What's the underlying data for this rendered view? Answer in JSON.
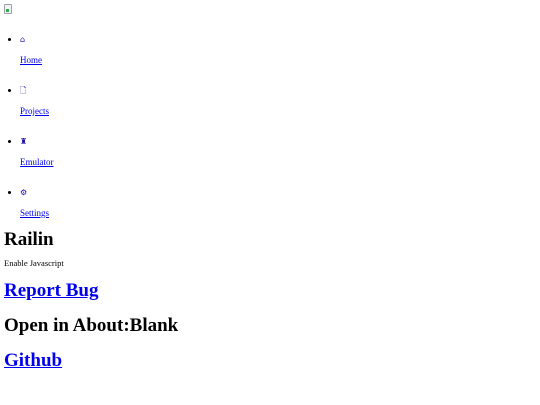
{
  "header": {
    "logo_icon": "broken-image-icon"
  },
  "nav": {
    "items": [
      {
        "icon": "home-icon",
        "glyph": "⌂",
        "label": "Home"
      },
      {
        "icon": "file-icon",
        "glyph": "🗋",
        "label": "Projects"
      },
      {
        "icon": "joystick-icon",
        "glyph": "♜",
        "label": "Emulator"
      },
      {
        "icon": "gear-icon",
        "glyph": "⚙",
        "label": "Settings"
      }
    ]
  },
  "main": {
    "title": "Railin",
    "noscript": "Enable Javascript",
    "report_bug": "Report Bug",
    "open_blank": "Open in About:Blank",
    "github": "Github"
  },
  "colors": {
    "link": "#0000ee",
    "text": "#000000",
    "background": "#ffffff"
  }
}
